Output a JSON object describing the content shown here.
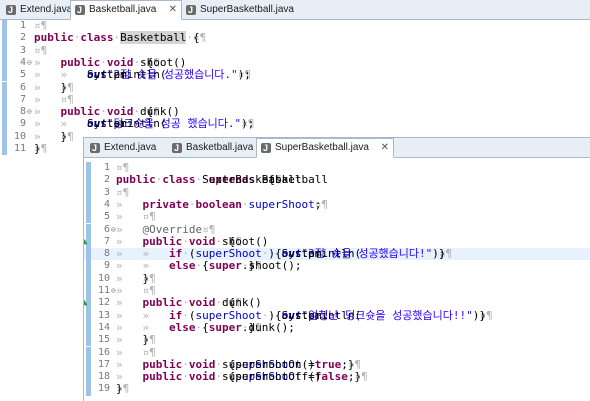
{
  "back_editor": {
    "tabs": [
      {
        "label": "Extend.java",
        "active": false
      },
      {
        "label": "Basketball.java",
        "active": true
      },
      {
        "label": "SuperBasketball.java",
        "active": false
      }
    ],
    "lines": [
      {
        "n": "1",
        "segs": [
          [
            "ws",
            "¤¶"
          ]
        ]
      },
      {
        "n": "2",
        "segs": [
          [
            "kw",
            "public"
          ],
          [
            "ws",
            "·"
          ],
          [
            "kw",
            "class"
          ],
          [
            "ws",
            "·"
          ],
          [
            "hl",
            "Basketball"
          ],
          [
            "ws",
            "·"
          ],
          [
            "txt",
            "{"
          ],
          [
            "ws",
            "¤¶"
          ]
        ]
      },
      {
        "n": "3",
        "segs": [
          [
            "ws",
            "¤¶"
          ]
        ]
      },
      {
        "n": "4",
        "segs": [
          [
            "ws",
            "»   "
          ],
          [
            "kw",
            "public"
          ],
          [
            "ws",
            "·"
          ],
          [
            "kw",
            "void"
          ],
          [
            "ws",
            "·"
          ],
          [
            "txt",
            "shoot()"
          ],
          [
            "ws",
            "·"
          ],
          [
            "txt",
            "{"
          ],
          [
            "ws",
            "¤¶"
          ]
        ]
      },
      {
        "n": "5",
        "segs": [
          [
            "ws",
            "»   »   "
          ],
          [
            "txt",
            "System."
          ],
          [
            "sfld",
            "out"
          ],
          [
            "txt",
            ".println("
          ],
          [
            "str",
            "\"2점 슛을 성공했습니다.\""
          ],
          [
            "txt",
            ");"
          ],
          [
            "ws",
            "¤¶"
          ]
        ]
      },
      {
        "n": "6",
        "segs": [
          [
            "ws",
            "»   "
          ],
          [
            "txt",
            "}"
          ],
          [
            "ws",
            "¤¶"
          ]
        ]
      },
      {
        "n": "7",
        "segs": [
          [
            "ws",
            "»   ¤¶"
          ]
        ]
      },
      {
        "n": "8",
        "segs": [
          [
            "ws",
            "»   "
          ],
          [
            "kw",
            "public"
          ],
          [
            "ws",
            "·"
          ],
          [
            "kw",
            "void"
          ],
          [
            "ws",
            "·"
          ],
          [
            "txt",
            "dunk()"
          ],
          [
            "ws",
            "·"
          ],
          [
            "txt",
            "{"
          ],
          [
            "ws",
            "¤¶"
          ]
        ]
      },
      {
        "n": "9",
        "segs": [
          [
            "ws",
            "»   »   "
          ],
          [
            "txt",
            "System."
          ],
          [
            "sfld",
            "out"
          ],
          [
            "txt",
            ".println("
          ],
          [
            "str",
            "\"덩크슛을 성공 했습니다.\""
          ],
          [
            "txt",
            ");"
          ],
          [
            "ws",
            "¤¶"
          ]
        ]
      },
      {
        "n": "10",
        "segs": [
          [
            "ws",
            "»   "
          ],
          [
            "txt",
            "}"
          ],
          [
            "ws",
            "¤¶"
          ]
        ]
      },
      {
        "n": "11",
        "segs": [
          [
            "txt",
            "}"
          ],
          [
            "ws",
            "¤¶"
          ]
        ]
      }
    ]
  },
  "front_editor": {
    "tabs": [
      {
        "label": "Extend.java",
        "active": false
      },
      {
        "label": "Basketball.java",
        "active": false
      },
      {
        "label": "SuperBasketball.java",
        "active": true
      }
    ],
    "lines": [
      {
        "n": "1",
        "segs": [
          [
            "ws",
            "¤¶"
          ]
        ]
      },
      {
        "n": "2",
        "segs": [
          [
            "kw",
            "public"
          ],
          [
            "ws",
            "·"
          ],
          [
            "kw",
            "class"
          ],
          [
            "ws",
            "·"
          ],
          [
            "txt",
            "SuperBasketball"
          ],
          [
            "ws",
            "·"
          ],
          [
            "kw",
            "extends"
          ],
          [
            "ws",
            "·"
          ],
          [
            "txt",
            "Basketball"
          ],
          [
            "ws",
            "·"
          ],
          [
            "txt",
            "{"
          ],
          [
            "ws",
            "¤¶"
          ]
        ]
      },
      {
        "n": "3",
        "segs": [
          [
            "ws",
            "¤¶"
          ]
        ]
      },
      {
        "n": "4",
        "segs": [
          [
            "ws",
            "»   "
          ],
          [
            "kw",
            "private"
          ],
          [
            "ws",
            "·"
          ],
          [
            "kw",
            "boolean"
          ],
          [
            "ws",
            "·"
          ],
          [
            "fld",
            "superShoot"
          ],
          [
            "txt",
            ";"
          ],
          [
            "ws",
            "¤¶"
          ]
        ]
      },
      {
        "n": "5",
        "segs": [
          [
            "ws",
            "»   ¤¶"
          ]
        ]
      },
      {
        "n": "6",
        "segs": [
          [
            "ws",
            "»   "
          ],
          [
            "ann",
            "@Override"
          ],
          [
            "ws",
            "¤¶"
          ]
        ]
      },
      {
        "n": "7",
        "segs": [
          [
            "ws",
            "»   "
          ],
          [
            "kw",
            "public"
          ],
          [
            "ws",
            "·"
          ],
          [
            "kw",
            "void"
          ],
          [
            "ws",
            "·"
          ],
          [
            "txt",
            "shoot()"
          ],
          [
            "ws",
            "·"
          ],
          [
            "txt",
            "{"
          ],
          [
            "ws",
            "¤¶"
          ]
        ]
      },
      {
        "n": "8",
        "segs": [
          [
            "ws",
            "»   »   "
          ],
          [
            "kw",
            "if"
          ],
          [
            "ws",
            "·"
          ],
          [
            "txt",
            "("
          ],
          [
            "ws",
            "·"
          ],
          [
            "fld",
            "superShoot"
          ],
          [
            "ws",
            "·"
          ],
          [
            "txt",
            ")"
          ],
          [
            "ws",
            "·"
          ],
          [
            "txt",
            "{"
          ],
          [
            "ws",
            "·"
          ],
          [
            "txt",
            "System."
          ],
          [
            "sfld",
            "out"
          ],
          [
            "txt",
            ".println("
          ],
          [
            "str",
            "\"3점 슛을 성공했습니다!\""
          ],
          [
            "txt",
            ");"
          ],
          [
            "ws",
            "·"
          ],
          [
            "txt",
            "}"
          ],
          [
            "ws",
            "¤¶"
          ]
        ]
      },
      {
        "n": "9",
        "segs": [
          [
            "ws",
            "»   »   "
          ],
          [
            "kw",
            "else"
          ],
          [
            "ws",
            "·"
          ],
          [
            "txt",
            "{"
          ],
          [
            "ws",
            "·"
          ],
          [
            "kw",
            "super"
          ],
          [
            "txt",
            ".shoot();"
          ],
          [
            "ws",
            "·"
          ],
          [
            "txt",
            "}"
          ],
          [
            "ws",
            "¤¶"
          ]
        ]
      },
      {
        "n": "10",
        "segs": [
          [
            "ws",
            "»   "
          ],
          [
            "txt",
            "}"
          ],
          [
            "ws",
            "¤¶"
          ]
        ]
      },
      {
        "n": "11",
        "segs": [
          [
            "ws",
            "»   ¤¶"
          ]
        ]
      },
      {
        "n": "12",
        "segs": [
          [
            "ws",
            "»   "
          ],
          [
            "kw",
            "public"
          ],
          [
            "ws",
            "·"
          ],
          [
            "kw",
            "void"
          ],
          [
            "ws",
            "·"
          ],
          [
            "txt",
            "dunk()"
          ],
          [
            "ws",
            "·"
          ],
          [
            "txt",
            "{"
          ],
          [
            "ws",
            "¤¶"
          ]
        ]
      },
      {
        "n": "13",
        "segs": [
          [
            "ws",
            "»   »   "
          ],
          [
            "kw",
            "if"
          ],
          [
            "ws",
            "·"
          ],
          [
            "txt",
            "("
          ],
          [
            "ws",
            "·"
          ],
          [
            "fld",
            "superShoot"
          ],
          [
            "ws",
            "·"
          ],
          [
            "txt",
            ")"
          ],
          [
            "ws",
            "·"
          ],
          [
            "txt",
            "{"
          ],
          [
            "ws",
            "·"
          ],
          [
            "txt",
            "System."
          ],
          [
            "sfld",
            "out"
          ],
          [
            "txt",
            ".println("
          ],
          [
            "str",
            "\"엄청난 덩크슛을 성공했습니다!!\""
          ],
          [
            "txt",
            ");"
          ],
          [
            "ws",
            "·"
          ],
          [
            "txt",
            "}"
          ],
          [
            "ws",
            "¤¶"
          ]
        ]
      },
      {
        "n": "14",
        "segs": [
          [
            "ws",
            "»   »   "
          ],
          [
            "kw",
            "else"
          ],
          [
            "ws",
            "·"
          ],
          [
            "txt",
            "{"
          ],
          [
            "ws",
            "·"
          ],
          [
            "kw",
            "super"
          ],
          [
            "txt",
            ".dunk();"
          ],
          [
            "ws",
            "·"
          ],
          [
            "txt",
            "}"
          ],
          [
            "ws",
            "¤¶"
          ]
        ]
      },
      {
        "n": "15",
        "segs": [
          [
            "ws",
            "»   "
          ],
          [
            "txt",
            "}"
          ],
          [
            "ws",
            "¤¶"
          ]
        ]
      },
      {
        "n": "16",
        "segs": [
          [
            "ws",
            "»   ¤¶"
          ]
        ]
      },
      {
        "n": "17",
        "segs": [
          [
            "ws",
            "»   "
          ],
          [
            "kw",
            "public"
          ],
          [
            "ws",
            "·"
          ],
          [
            "kw",
            "void"
          ],
          [
            "ws",
            "·"
          ],
          [
            "txt",
            "superShootOn()"
          ],
          [
            "ws",
            "·"
          ],
          [
            "txt",
            "{"
          ],
          [
            "ws",
            "·"
          ],
          [
            "fld",
            "superShoot"
          ],
          [
            "ws",
            "·"
          ],
          [
            "txt",
            "="
          ],
          [
            "ws",
            "·"
          ],
          [
            "kw",
            "true"
          ],
          [
            "txt",
            ";"
          ],
          [
            "ws",
            "·"
          ],
          [
            "txt",
            "}"
          ],
          [
            "ws",
            "¤¶"
          ]
        ]
      },
      {
        "n": "18",
        "segs": [
          [
            "ws",
            "»   "
          ],
          [
            "kw",
            "public"
          ],
          [
            "ws",
            "·"
          ],
          [
            "kw",
            "void"
          ],
          [
            "ws",
            "·"
          ],
          [
            "txt",
            "superShootOff()"
          ],
          [
            "ws",
            "·"
          ],
          [
            "txt",
            "{"
          ],
          [
            "ws",
            "·"
          ],
          [
            "fld",
            "superShoot"
          ],
          [
            "ws",
            "·"
          ],
          [
            "txt",
            "="
          ],
          [
            "ws",
            "·"
          ],
          [
            "kw",
            "false"
          ],
          [
            "txt",
            ";"
          ],
          [
            "ws",
            "·"
          ],
          [
            "txt",
            "}"
          ],
          [
            "ws",
            "¤¶"
          ]
        ]
      },
      {
        "n": "19",
        "segs": [
          [
            "txt",
            "}"
          ],
          [
            "ws",
            "¤¶"
          ]
        ]
      }
    ]
  },
  "colors": {
    "keyword": "#7f0055",
    "string": "#2a00ff",
    "field": "#0000c0",
    "annotation": "#646464",
    "whitespace_marker": "#b3b3b3",
    "override_marker": "#2a9d39"
  },
  "icons": {
    "tab_icon": "java-file-icon",
    "tab_close": "close-icon",
    "override": "override-triangle-icon",
    "fold": "fold-toggle-icon"
  }
}
